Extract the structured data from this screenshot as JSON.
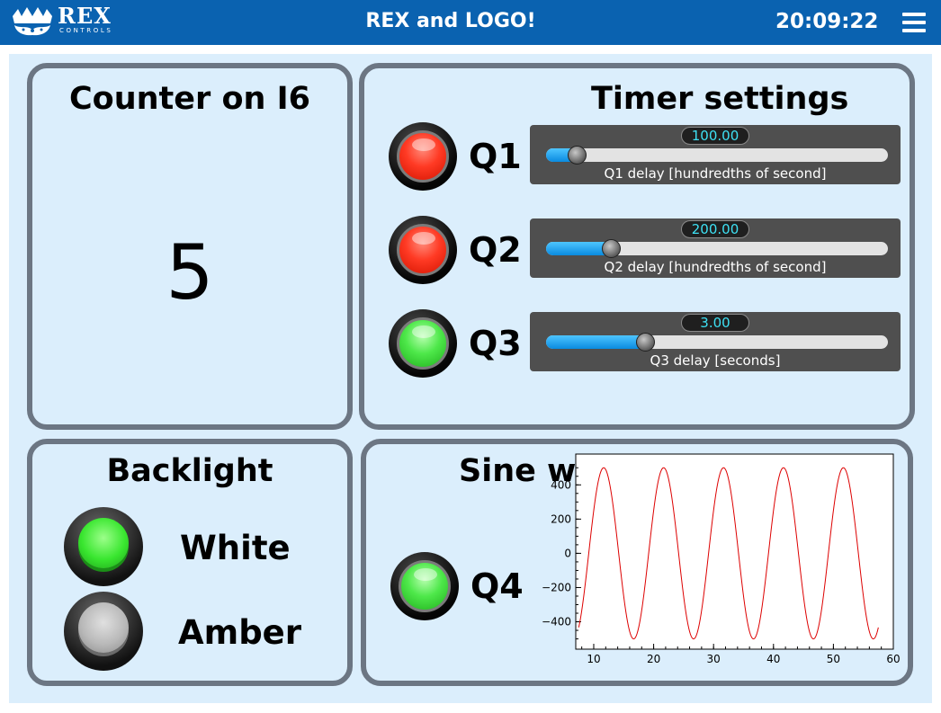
{
  "header": {
    "logo_main": "REX",
    "logo_sub": "CONTROLS",
    "title": "REX and LOGO!",
    "time": "20:09:22"
  },
  "counter_panel": {
    "title": "Counter on I6",
    "value": "5"
  },
  "timer_panel": {
    "title": "Timer settings",
    "rows": [
      {
        "label": "Q1",
        "led": "red",
        "value": "100.00",
        "caption": "Q1 delay [hundredths of second]",
        "fill_fraction": 0.09
      },
      {
        "label": "Q2",
        "led": "red",
        "value": "200.00",
        "caption": "Q2 delay [hundredths of second]",
        "fill_fraction": 0.19
      },
      {
        "label": "Q3",
        "led": "green",
        "value": "3.00",
        "caption": "Q3 delay [seconds]",
        "fill_fraction": 0.29
      }
    ]
  },
  "backlight_panel": {
    "title": "Backlight",
    "items": [
      {
        "label": "White",
        "state": "on"
      },
      {
        "label": "Amber",
        "state": "off"
      }
    ]
  },
  "sine_panel": {
    "title": "Sine wave generator",
    "output_label": "Q4",
    "led": "green"
  },
  "colors": {
    "header": "#0a62b0",
    "background": "#dbeefc",
    "panel_border": "#6c7683",
    "slider_value_text": "#3ee0f3",
    "sine_line": "#dd0000"
  },
  "chart_data": {
    "type": "line",
    "title": "",
    "xlabel": "",
    "ylabel": "",
    "xlim": [
      7,
      60
    ],
    "ylim": [
      -560,
      580
    ],
    "x_ticks": [
      10,
      20,
      30,
      40,
      50,
      60
    ],
    "y_ticks": [
      400,
      200,
      0,
      -200,
      -400
    ],
    "y_tick_labels": [
      "400",
      "200",
      "0",
      "−200",
      "−400"
    ],
    "grid": true,
    "series": [
      {
        "amplitude": 500,
        "period": 10,
        "phase_deg": 30,
        "x_start": 7.5,
        "x_end": 57.5
      }
    ]
  }
}
